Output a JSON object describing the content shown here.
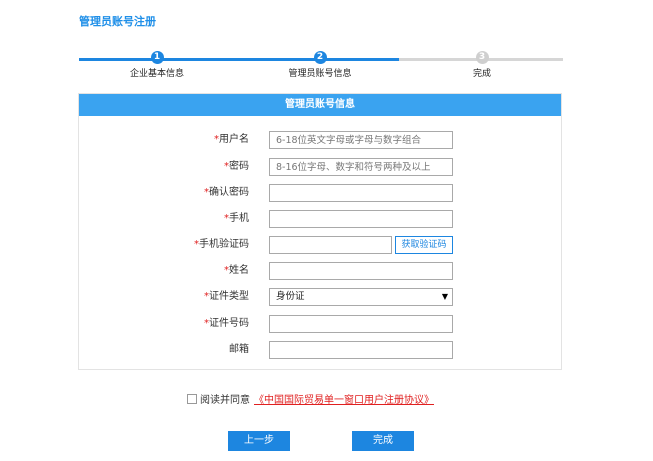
{
  "page_title": "管理员账号注册",
  "steps": [
    {
      "number": "1",
      "label": "企业基本信息",
      "state": "done"
    },
    {
      "number": "2",
      "label": "管理员账号信息",
      "state": "current"
    },
    {
      "number": "3",
      "label": "完成",
      "state": "pending"
    }
  ],
  "panel_title": "管理员账号信息",
  "required_mark": "*",
  "fields": {
    "username": {
      "label": "用户名",
      "required": true,
      "placeholder": "6-18位英文字母或字母与数字组合",
      "value": ""
    },
    "password": {
      "label": "密码",
      "required": true,
      "placeholder": "8-16位字母、数字和符号两种及以上",
      "value": ""
    },
    "confirm_password": {
      "label": "确认密码",
      "required": true,
      "placeholder": "",
      "value": ""
    },
    "phone": {
      "label": "手机",
      "required": true,
      "placeholder": "",
      "value": ""
    },
    "sms_code": {
      "label": "手机验证码",
      "required": true,
      "placeholder": "",
      "value": "",
      "button": "获取验证码"
    },
    "name": {
      "label": "姓名",
      "required": true,
      "placeholder": "",
      "value": ""
    },
    "id_type": {
      "label": "证件类型",
      "required": true,
      "selected": "身份证"
    },
    "id_number": {
      "label": "证件号码",
      "required": true,
      "placeholder": "",
      "value": ""
    },
    "email": {
      "label": "邮箱",
      "required": false,
      "placeholder": "",
      "value": ""
    }
  },
  "agreement": {
    "checked": false,
    "prefix": "阅读并同意",
    "link_text": "《中国国际贸易单一窗口用户注册协议》"
  },
  "buttons": {
    "prev": "上一步",
    "finish": "完成"
  },
  "colors": {
    "accent": "#1d86e0",
    "header": "#3aa3f0",
    "required": "#e02020"
  }
}
